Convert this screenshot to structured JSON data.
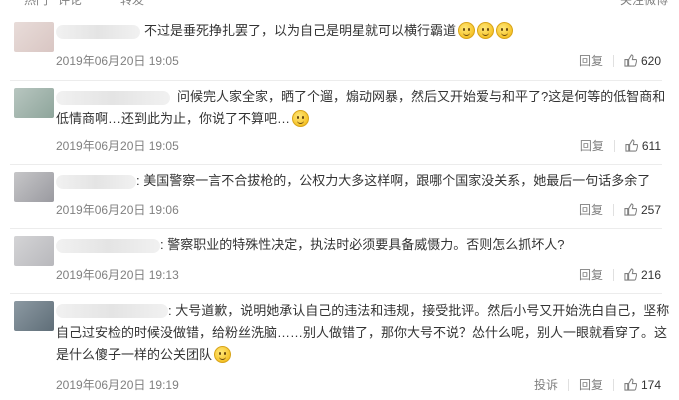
{
  "header": {
    "items": [
      "热门",
      "评论",
      "转发",
      "关注微博"
    ]
  },
  "actions": {
    "reply": "回复",
    "report": "投诉"
  },
  "comments": [
    {
      "lines": [
        "不过是垂死挣扎罢了，以为自己是明星就可以横行霸道"
      ],
      "time": "2019年06月20日 19:05",
      "likes": "620"
    },
    {
      "lines": [
        "问候完人家全家，晒了个遛，煽动网暴，然后又开始爱与和平了?这是何等的低智商和",
        "低情商啊…还到此为止，你说了不算吧…"
      ],
      "time": "2019年06月20日 19:05",
      "likes": "611"
    },
    {
      "lines": [
        "美国警察一言不合拔枪的，公权力大多这样啊，跟哪个国家没关系，她最后一句话多余了"
      ],
      "time": "2019年06月20日 19:06",
      "likes": "257"
    },
    {
      "lines": [
        "警察职业的特殊性决定，执法时必须要具备威慑力。否则怎么抓坏人?"
      ],
      "time": "2019年06月20日 19:13",
      "likes": "216"
    },
    {
      "lines": [
        "大号道歉，说明她承认自己的违法和违规，接受批评。然后小号又开始洗白自己，坚称",
        "自己过安检的时候没做错，给粉丝洗脑……别人做错了，那你大号不说？怂什么呢，别人一眼就看穿了。这",
        "是什么傻子一样的公关团队"
      ],
      "time": "2019年06月20日 19:19",
      "likes": "174"
    }
  ]
}
